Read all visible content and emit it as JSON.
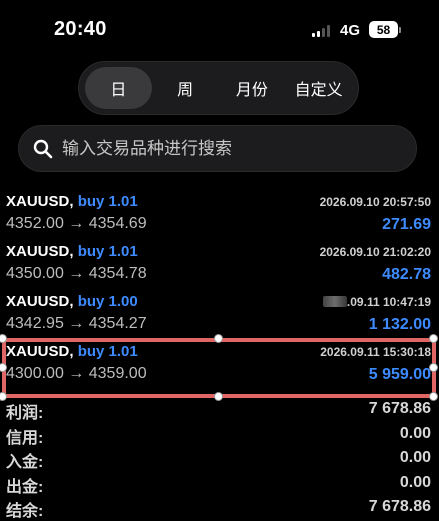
{
  "status_bar": {
    "time": "20:40",
    "network": "4G",
    "battery": "58"
  },
  "period_tabs": [
    {
      "label": "日",
      "active": true
    },
    {
      "label": "周",
      "active": false
    },
    {
      "label": "月份",
      "active": false
    },
    {
      "label": "自定义",
      "active": false
    }
  ],
  "search": {
    "placeholder": "输入交易品种进行搜索"
  },
  "trades": [
    {
      "symbol": "XAUUSD,",
      "side": "buy 1.01",
      "time": "2026.09.10 20:57:50",
      "open": "4352.00",
      "close": "4354.69",
      "profit": "271.69"
    },
    {
      "symbol": "XAUUSD,",
      "side": "buy 1.01",
      "time": "2026.09.10 21:02:20",
      "open": "4350.00",
      "close": "4354.78",
      "profit": "482.78"
    },
    {
      "symbol": "XAUUSD,",
      "side": "buy 1.00",
      "time": ".09.11 10:47:19",
      "open": "4342.95",
      "close": "4354.27",
      "profit": "1 132.00"
    },
    {
      "symbol": "XAUUSD,",
      "side": "buy 1.01",
      "time": "2026.09.11 15:30:18",
      "open": "4300.00",
      "close": "4359.00",
      "profit": "5 959.00"
    }
  ],
  "arrow": "→",
  "summary": [
    {
      "label": "利润:",
      "value": "7 678.86"
    },
    {
      "label": "信用:",
      "value": "0.00"
    },
    {
      "label": "入金:",
      "value": "0.00"
    },
    {
      "label": "出金:",
      "value": "0.00"
    },
    {
      "label": "结余:",
      "value": "7 678.86"
    }
  ],
  "colors": {
    "accent_blue": "#3d8bff",
    "highlight_red": "#e06666",
    "background": "#000000"
  }
}
